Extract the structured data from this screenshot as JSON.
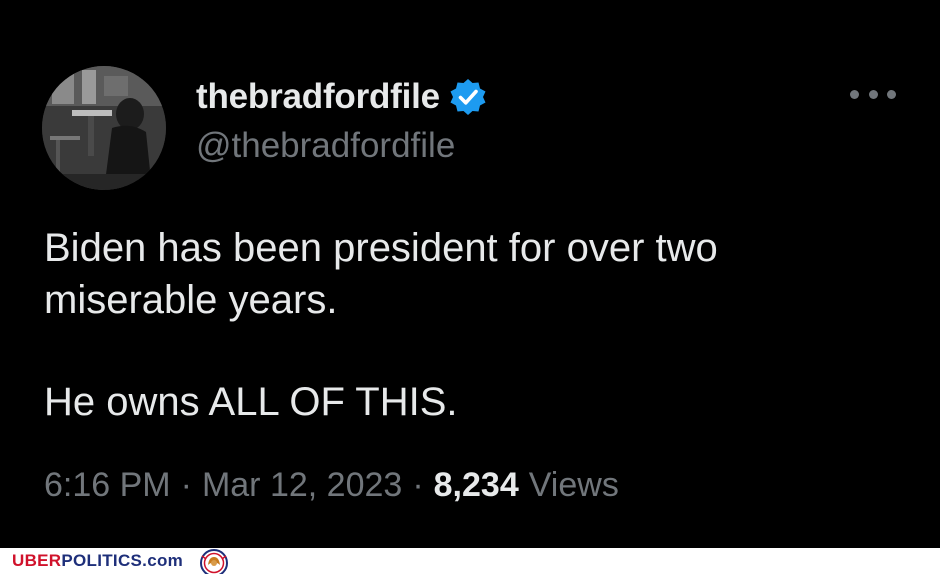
{
  "user": {
    "display_name": "thebradfordfile",
    "handle": "@thebradfordfile",
    "verified": true,
    "avatar": "user-avatar-photo"
  },
  "tweet": {
    "lines": [
      "Biden has been president for over two",
      "miserable years.",
      "He owns ALL OF THIS."
    ]
  },
  "meta": {
    "time": "6:16 PM",
    "separator": "·",
    "date": "Mar 12, 2023",
    "views_count": "8,234",
    "views_label": "Views"
  },
  "icons": {
    "verified": "verified-badge-icon",
    "more": "more-options-icon"
  },
  "colors": {
    "background": "#000000",
    "text": "#e7e9ea",
    "secondary_text": "#71767b",
    "verified_blue": "#1d9bf0",
    "brand_red": "#d0122b",
    "brand_blue": "#1e2f7a"
  },
  "watermark": {
    "brand_uber": "UBER",
    "brand_politics": "POLITICS",
    "brand_com": ".com"
  }
}
